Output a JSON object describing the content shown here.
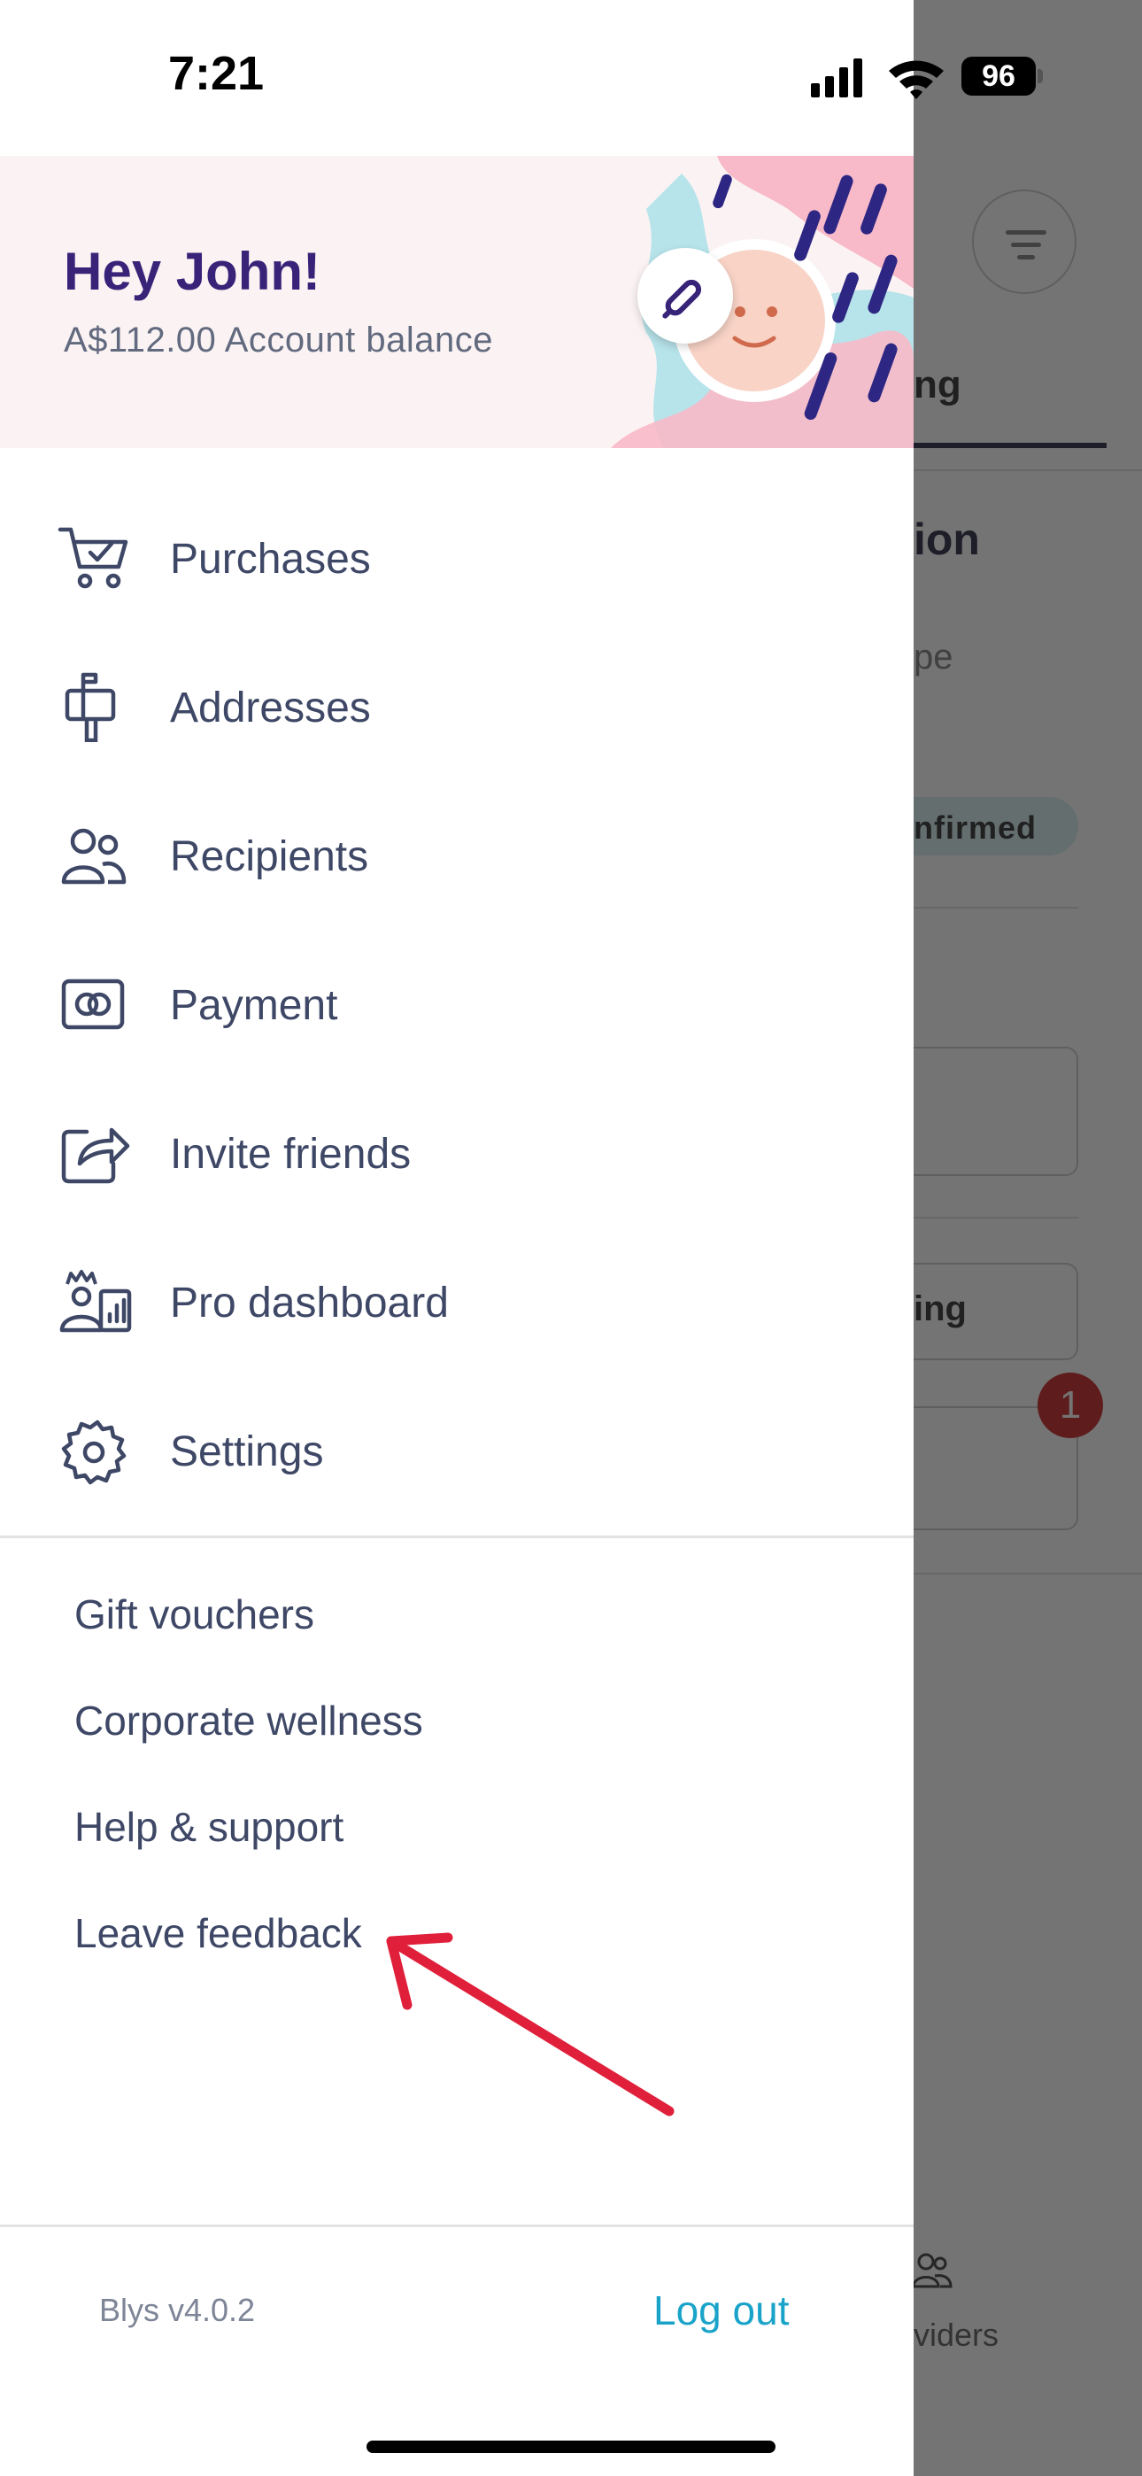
{
  "status_bar": {
    "time": "7:21",
    "battery": "96"
  },
  "background": {
    "tab_fragment": "ng",
    "title_fragment": "ion",
    "subtitle_fragment": "pe",
    "badge_fragment": "nfirmed",
    "button_fragment": "ing",
    "notification_count": "1",
    "nav_label_fragment": "viders"
  },
  "drawer": {
    "greeting": "Hey John!",
    "balance": "A$112.00 Account balance",
    "menu": [
      {
        "label": "Purchases",
        "icon": "cart-check-icon"
      },
      {
        "label": "Addresses",
        "icon": "mailbox-icon"
      },
      {
        "label": "Recipients",
        "icon": "people-icon"
      },
      {
        "label": "Payment",
        "icon": "card-icon"
      },
      {
        "label": "Invite friends",
        "icon": "share-icon"
      },
      {
        "label": "Pro dashboard",
        "icon": "pro-dashboard-icon"
      },
      {
        "label": "Settings",
        "icon": "gear-icon"
      }
    ],
    "links": [
      "Gift vouchers",
      "Corporate wellness",
      "Help & support",
      "Leave feedback"
    ],
    "version": "Blys v4.0.2",
    "logout": "Log out"
  },
  "colors": {
    "brand_purple": "#372479",
    "text": "#3e4866",
    "link_blue": "#1aa3c9",
    "annotation_red": "#e0203a"
  }
}
